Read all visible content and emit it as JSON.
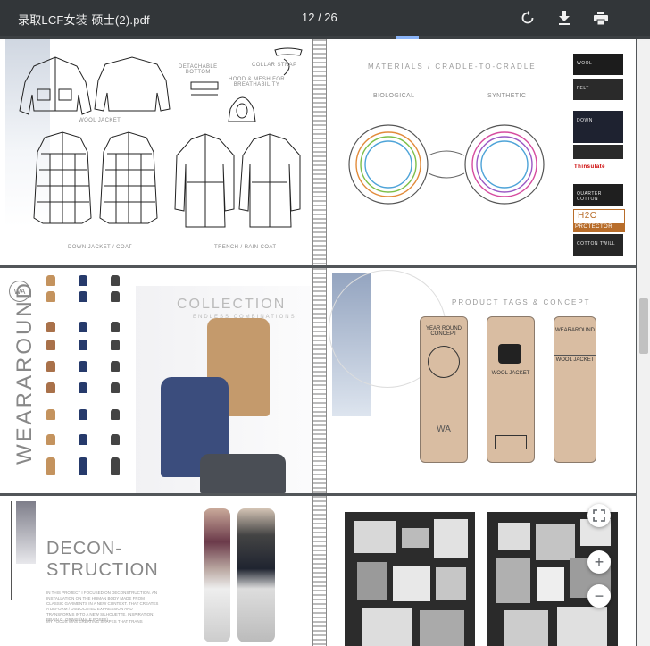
{
  "toolbar": {
    "title": "录取LCF女装-硕士(2).pdf",
    "page_indicator": "12 / 26",
    "rotate_icon": "rotate-icon",
    "download_icon": "download-icon",
    "print_icon": "print-icon"
  },
  "page1": {
    "left": {
      "detachable_bottom": "DETACHABLE\nBOTTOM",
      "collar_strap": "COLLAR STRAP",
      "hood": "HOOD & MESH FOR\nBREATHABILITY",
      "wool_jacket": "WOOL JACKET",
      "down_jacket": "DOWN JACKET / COAT",
      "trench": "TRENCH / RAIN COAT"
    },
    "right": {
      "heading": "MATERIALS / CRADLE-TO-CRADLE",
      "biological": "BIOLOGICAL",
      "synthetic": "SYNTHETIC",
      "swatches": [
        "WOOL",
        "FELT",
        "DOWN",
        "",
        "THINSULATE",
        "QUARTER COTTON",
        "H2O PROTECTOR",
        "COTTON TWILL"
      ],
      "thinsulate_brand": "Thinsulate",
      "h2o": "H2O",
      "protector": "PROTECTOR"
    }
  },
  "page2": {
    "left": {
      "brand_vertical": "WEARAROUND",
      "logo": "WA",
      "collection": "COLLECTION",
      "collection_sub": "ENDLESS COMBINATIONS"
    },
    "right": {
      "heading": "PRODUCT TAGS & CONCEPT",
      "tag1_title": "YEAR ROUND CONCEPT",
      "tag1_logo": "WA",
      "tag2_title": "WOOL JACKET",
      "tag3_brand": "WEARAROUND",
      "tag3_title": "WOOL JACKET"
    }
  },
  "page3": {
    "left": {
      "title_line1": "DECON-",
      "title_line2": "STRUCTION",
      "body": "IN THIS PROJECT I FOCUSED ON DECONSTRUCTION. AN INSTALLATION ON THE HUMAN BODY MADE FROM CLASSIC GARMENTS IN A NEW CONTEXT. THAT CREATES A DEFORM / DISLOCATED EXPRESSION AND TRANSFORMS INTO A NEW SILHOUETTE. INSPIRATION: BRAIN G. GRIMS (MALE POSES).",
      "body2": "MY FOCUS WAS CREATING SHAPES THAT TRANS"
    }
  },
  "controls": {
    "fit_icon": "fit-to-page-icon",
    "zoom_in": "+",
    "zoom_out": "−"
  },
  "colors": {
    "toolbar_bg": "#323639",
    "viewer_bg": "#525659",
    "progress": "#8ab4f8",
    "tag_bg": "#d9bda2"
  },
  "progress_fraction": 0.46
}
